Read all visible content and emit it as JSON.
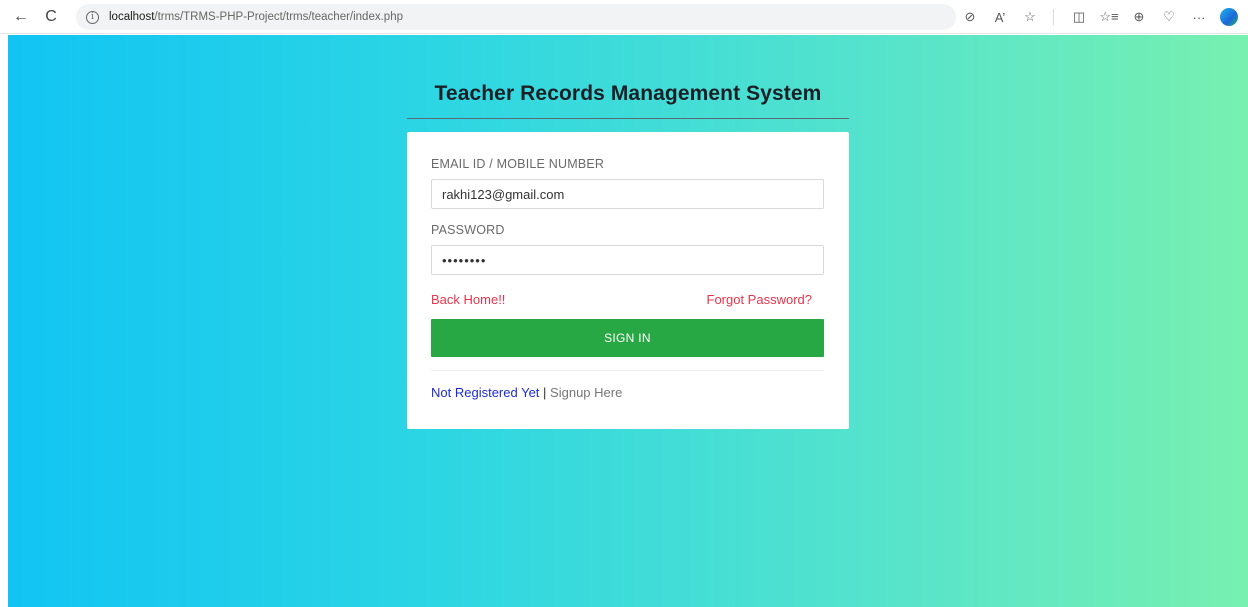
{
  "browser": {
    "url_host": "localhost",
    "url_path": "/trms/TRMS-PHP-Project/trms/teacher/index.php",
    "back_icon": "←",
    "reload_icon": "C",
    "info_icon": "i",
    "toolbar_icons": [
      "⊘",
      "A’",
      "☆",
      "◫",
      "☆≡",
      "⊕",
      "♡",
      "···"
    ]
  },
  "page": {
    "title": "Teacher Records Management System",
    "gradient": [
      "#11c4f3",
      "#78f0b0"
    ]
  },
  "login": {
    "email_label": "EMAIL ID / MOBILE NUMBER",
    "email_value": "rakhi123@gmail.com",
    "password_label": "PASSWORD",
    "password_value": "••••••••",
    "back_home": "Back Home!!",
    "forgot_password": "Forgot Password?",
    "sign_in": "SIGN IN",
    "not_registered": "Not Registered Yet",
    "separator": "|",
    "signup": "Signup Here",
    "accent_button": "#28a745",
    "accent_link": "#e8344a"
  }
}
